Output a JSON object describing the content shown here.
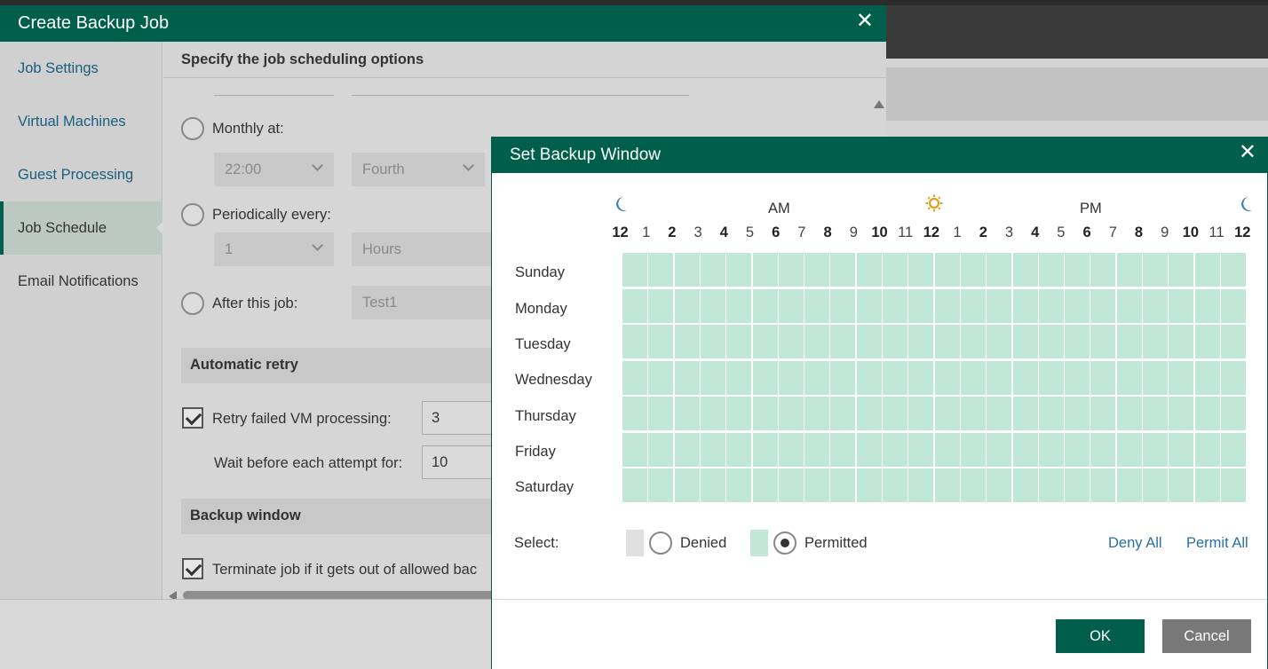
{
  "wizard": {
    "title": "Create Backup Job",
    "nav": [
      "Job Settings",
      "Virtual Machines",
      "Guest Processing",
      "Job Schedule",
      "Email Notifications"
    ],
    "active_nav": "Job Schedule",
    "heading": "Specify the job scheduling options",
    "monthly_label": "Monthly at:",
    "monthly_time": "22:00",
    "monthly_week": "Fourth",
    "periodically_label": "Periodically every:",
    "periodically_value": "1",
    "periodically_unit": "Hours",
    "after_job_label": "After this job:",
    "after_job_value": "Test1",
    "retry_section": "Automatic retry",
    "retry_label": "Retry failed VM processing:",
    "retry_count": "3",
    "wait_label": "Wait before each attempt for:",
    "wait_value": "10",
    "window_section": "Backup window",
    "terminate_label": "Terminate job if it gets out of allowed bac"
  },
  "dialog": {
    "title": "Set Backup Window",
    "am_label": "AM",
    "pm_label": "PM",
    "hours": [
      "12",
      "1",
      "2",
      "3",
      "4",
      "5",
      "6",
      "7",
      "8",
      "9",
      "10",
      "11",
      "12",
      "1",
      "2",
      "3",
      "4",
      "5",
      "6",
      "7",
      "8",
      "9",
      "10",
      "11",
      "12"
    ],
    "bold_hours": [
      0,
      2,
      4,
      6,
      8,
      10,
      12,
      14,
      16,
      18,
      20,
      22,
      24
    ],
    "days": [
      "Sunday",
      "Monday",
      "Tuesday",
      "Wednesday",
      "Thursday",
      "Friday",
      "Saturday"
    ],
    "select_label": "Select:",
    "denied_label": "Denied",
    "permitted_label": "Permitted",
    "selected_mode": "Permitted",
    "deny_all": "Deny All",
    "permit_all": "Permit All",
    "ok": "OK",
    "cancel": "Cancel",
    "colors": {
      "permitted": "#c1e8d7",
      "denied": "#e0e0e0",
      "accent": "#005f4b"
    },
    "schedule": "all permitted"
  },
  "icons": {
    "night": "moon-icon",
    "day": "sun-icon",
    "close": "close-icon"
  }
}
